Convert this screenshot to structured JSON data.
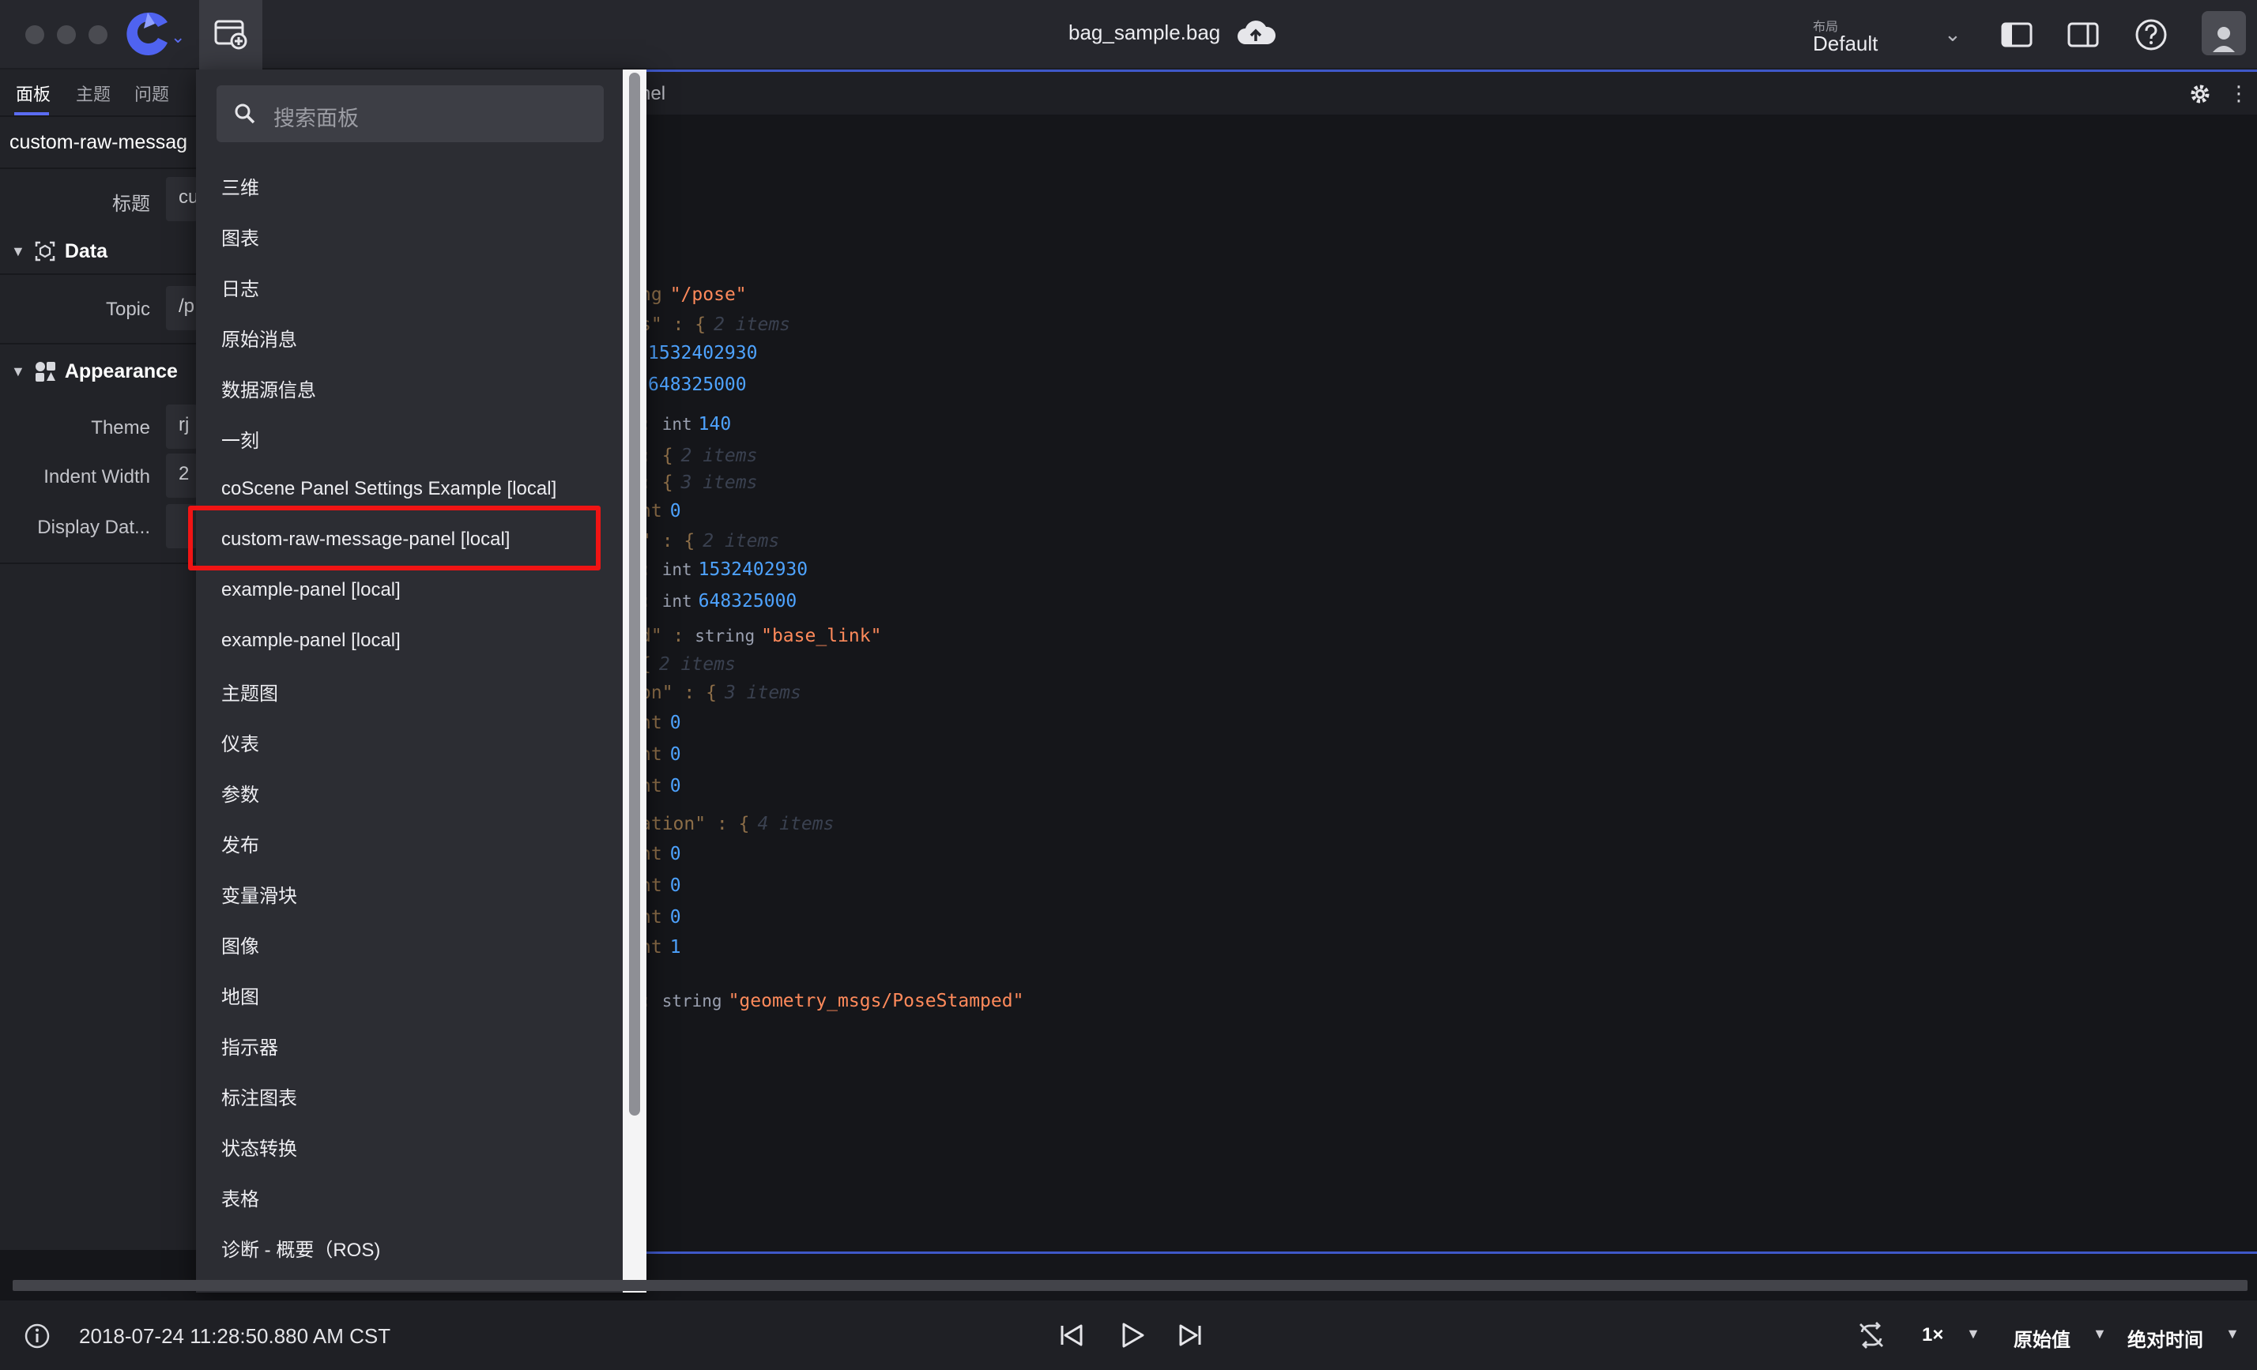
{
  "window": {
    "file_title": "bag_sample.bag",
    "layout_label": "布局",
    "layout_value": "Default"
  },
  "sidebar": {
    "tabs": [
      {
        "label": "面板"
      },
      {
        "label": "主题"
      },
      {
        "label": "问题"
      }
    ],
    "panel_name": "custom-raw-messag",
    "title_label": "标题",
    "title_value": "cu",
    "data_section": "Data",
    "topic_label": "Topic",
    "topic_value": "/p",
    "appearance_section": "Appearance",
    "theme_label": "Theme",
    "theme_value": "rj",
    "indent_label": "Indent Width",
    "indent_value": "2",
    "display_label": "Display Dat..."
  },
  "panel": {
    "title_fragment": "nel",
    "lines": [
      {
        "a": "ng",
        "b": "\"/pose\""
      },
      {
        "a": "s\" : {",
        "b": "2 items"
      },
      {
        "a": "",
        "b": "1532402930"
      },
      {
        "a": "",
        "b": "648325000"
      },
      {
        "a": ": ",
        "t": "int",
        "b": "140"
      },
      {
        "a": ": {",
        "b": "2 items"
      },
      {
        "a": ": {",
        "b": "3 items"
      },
      {
        "a": "nt",
        "b": "0"
      },
      {
        "a": "\" : {",
        "b": "2 items"
      },
      {
        "a": ": ",
        "t": "int",
        "b": "1532402930"
      },
      {
        "a": ": ",
        "t": "int",
        "b": "648325000"
      },
      {
        "a": "d\" : ",
        "t": "string",
        "b": "\"base_link\""
      },
      {
        "a": "{",
        "b": "2 items"
      },
      {
        "a": "on\" : {",
        "b": "3 items"
      },
      {
        "a": "nt",
        "b": "0"
      },
      {
        "a": "nt",
        "b": "0"
      },
      {
        "a": "nt",
        "b": "0"
      },
      {
        "a": "ation\" : {",
        "b": "4 items"
      },
      {
        "a": "nt",
        "b": "0"
      },
      {
        "a": "nt",
        "b": "0"
      },
      {
        "a": "nt",
        "b": "0"
      },
      {
        "a": "nt",
        "b": "1"
      },
      {
        "a": ": ",
        "t": "string",
        "b": "\"geometry_msgs/PoseStamped\""
      }
    ]
  },
  "menu": {
    "search_placeholder": "搜索面板",
    "items": [
      "三维",
      "图表",
      "日志",
      "原始消息",
      "数据源信息",
      "一刻",
      "coScene Panel Settings Example [local]",
      "custom-raw-message-panel [local]",
      "example-panel [local]",
      "example-panel [local]",
      "主题图",
      "仪表",
      "参数",
      "发布",
      "变量滑块",
      "图像",
      "地图",
      "指示器",
      "标注图表",
      "状态转换",
      "表格",
      "诊断 - 概要（ROS)"
    ]
  },
  "playback": {
    "timestamp": "2018-07-24 11:28:50.880 AM CST",
    "speed": "1×",
    "value_mode": "原始值",
    "time_mode": "绝对时间"
  },
  "colors": {
    "accent": "#5b6cf3",
    "highlight_box": "#f01414",
    "number": "#4ea3ff",
    "string": "#ff8a5b"
  }
}
